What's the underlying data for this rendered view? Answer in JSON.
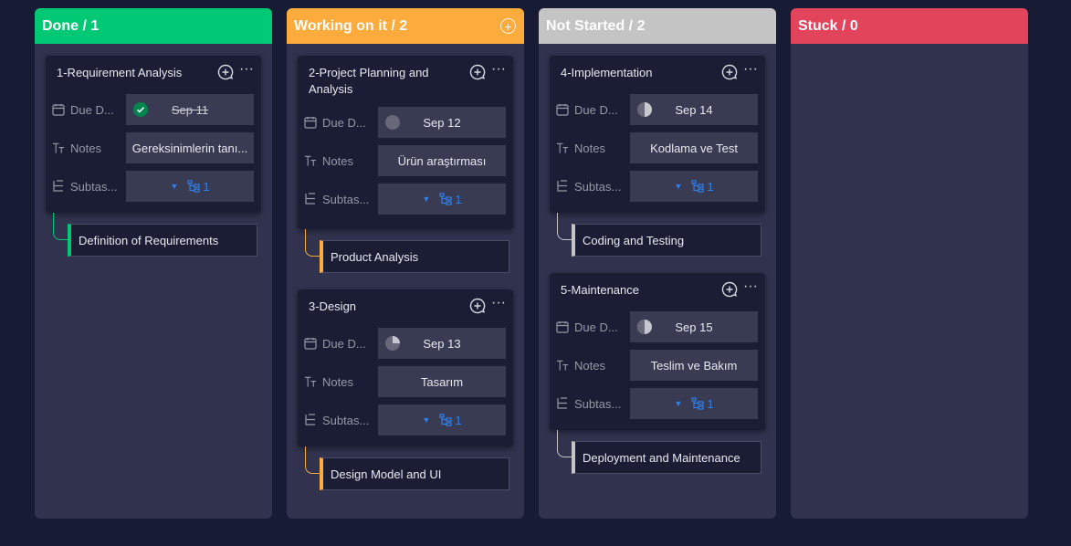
{
  "columns": [
    {
      "title": "Done / 1",
      "color": "#00c875",
      "cards": [
        {
          "title": "1-Requirement Analysis",
          "due_label": "Due D...",
          "due_value": "Sep 11",
          "notes_label": "Notes",
          "notes_value": "Gereksinimlerin tanı...",
          "subtasks_label": "Subtas...",
          "subtasks_count": "1",
          "subitem": "Definition of Requirements"
        }
      ]
    },
    {
      "title": "Working on it / 2",
      "color": "#fdab3d",
      "add_icon": "+",
      "cards": [
        {
          "title": "2-Project Planning and Analysis",
          "due_label": "Due D...",
          "due_value": "Sep 12",
          "notes_label": "Notes",
          "notes_value": "Ürün araştırması",
          "subtasks_label": "Subtas...",
          "subtasks_count": "1",
          "subitem": "Product Analysis"
        },
        {
          "title": "3-Design",
          "due_label": "Due D...",
          "due_value": "Sep 13",
          "notes_label": "Notes",
          "notes_value": "Tasarım",
          "subtasks_label": "Subtas...",
          "subtasks_count": "1",
          "subitem": "Design Model and UI"
        }
      ]
    },
    {
      "title": "Not Started / 2",
      "color": "#c4c4c4",
      "cards": [
        {
          "title": "4-Implementation",
          "due_label": "Due D...",
          "due_value": "Sep 14",
          "notes_label": "Notes",
          "notes_value": "Kodlama ve Test",
          "subtasks_label": "Subtas...",
          "subtasks_count": "1",
          "subitem": "Coding and Testing"
        },
        {
          "title": "5-Maintenance",
          "due_label": "Due D...",
          "due_value": "Sep 15",
          "notes_label": "Notes",
          "notes_value": "Teslim ve Bakım",
          "subtasks_label": "Subtas...",
          "subtasks_count": "1",
          "subitem": "Deployment and Maintenance"
        }
      ]
    },
    {
      "title": "Stuck / 0",
      "color": "#e2445c",
      "cards": []
    }
  ],
  "icons": {
    "more": "···",
    "caret": "▼"
  }
}
